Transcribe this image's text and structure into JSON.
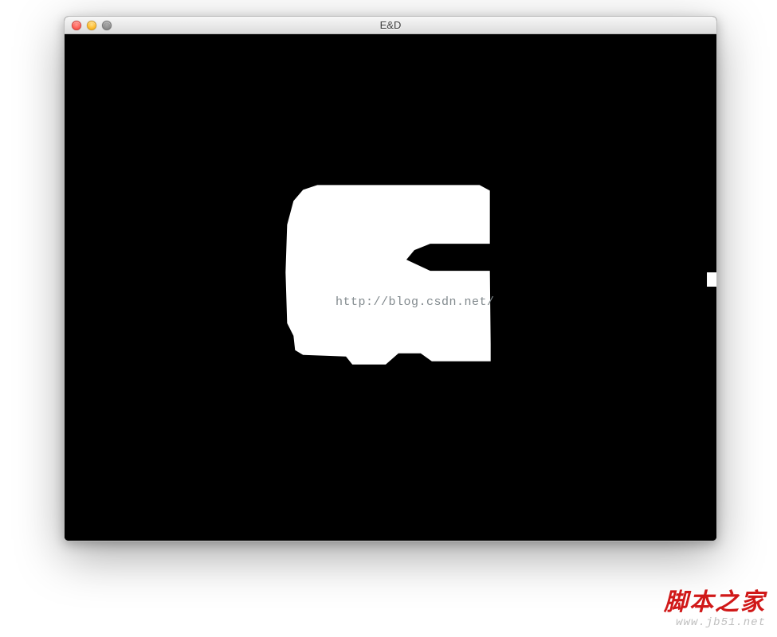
{
  "window": {
    "title": "E&D",
    "traffic_lights": {
      "close": "close",
      "minimize": "minimize",
      "zoom": "zoom"
    }
  },
  "content": {
    "watermark_url": "http://blog.csdn.net/",
    "image_description": "binary-threshold-blob",
    "colors": {
      "foreground": "#ffffff",
      "background": "#000000"
    }
  },
  "site_watermark": {
    "cn_text": "脚本之家",
    "en_text": "www.jb51.net"
  }
}
